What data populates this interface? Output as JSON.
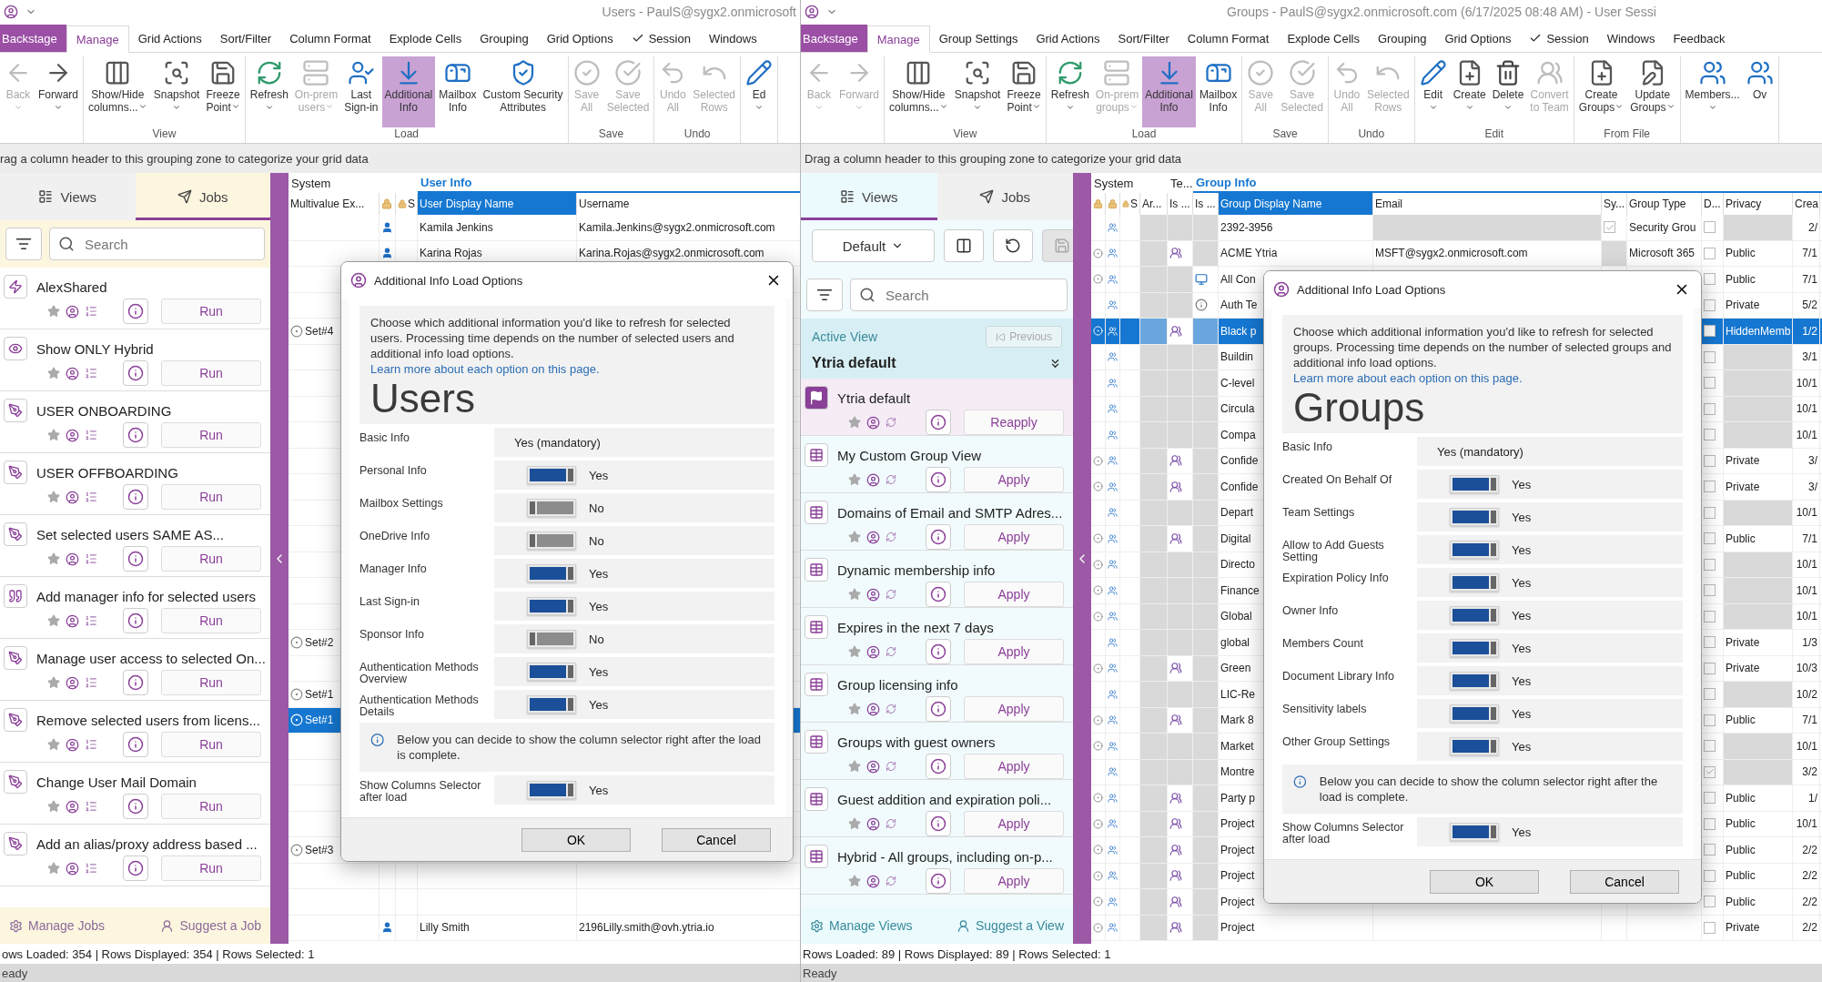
{
  "windows": [
    {
      "kind": "users",
      "title": "Users - PaulS@sygx2.onmicrosoft",
      "overlay_label": "Users",
      "tabs": [
        {
          "label": "Backstage",
          "kind": "backstage",
          "selected": false
        },
        {
          "label": "Manage",
          "kind": "tab",
          "selected": true
        },
        {
          "label": "Grid Actions",
          "kind": "tab",
          "selected": false
        },
        {
          "label": "Sort/Filter",
          "kind": "tab",
          "selected": false
        },
        {
          "label": "Column Format",
          "kind": "tab",
          "selected": false
        },
        {
          "label": "Explode Cells",
          "kind": "tab",
          "selected": false
        },
        {
          "label": "Grouping",
          "kind": "tab",
          "selected": false
        },
        {
          "label": "Grid Options",
          "kind": "tab",
          "selected": false
        },
        {
          "label": "Session",
          "kind": "check",
          "selected": false
        },
        {
          "label": "Windows",
          "kind": "tab",
          "selected": false
        }
      ],
      "ribbon": [
        {
          "buttons": [
            {
              "kind": "back",
              "label": "Back",
              "dropdown": true,
              "disabled": true,
              "highlighted": false
            },
            {
              "kind": "forward",
              "label": "Forward",
              "dropdown": true,
              "disabled": false,
              "highlighted": false
            }
          ]
        },
        {
          "label": "View",
          "buttons": [
            {
              "kind": "columns",
              "label": "Show/Hide\ncolumns...",
              "dropdown": true,
              "disabled": false,
              "highlighted": false
            },
            {
              "kind": "snapshot",
              "label": "Snapshot",
              "dropdown": true,
              "disabled": false,
              "highlighted": false
            },
            {
              "kind": "freeze",
              "label": "Freeze\nPoint",
              "dropdown": true,
              "disabled": false,
              "highlighted": false
            }
          ]
        },
        {
          "label": "Load",
          "buttons": [
            {
              "kind": "refresh",
              "label": "Refresh",
              "dropdown": true,
              "disabled": false,
              "highlighted": false
            },
            {
              "kind": "server",
              "label": "On-prem\nusers",
              "dropdown": true,
              "disabled": true,
              "highlighted": false
            },
            {
              "kind": "signin",
              "label": "Last\nSign-in",
              "dropdown": false,
              "disabled": false,
              "highlighted": false
            },
            {
              "kind": "download",
              "label": "Additional\nInfo",
              "dropdown": false,
              "disabled": false,
              "highlighted": true
            },
            {
              "kind": "mailbox",
              "label": "Mailbox\nInfo",
              "dropdown": false,
              "disabled": false,
              "highlighted": false
            },
            {
              "kind": "shield",
              "label": "Custom Security\nAttributes",
              "dropdown": false,
              "disabled": false,
              "highlighted": false
            }
          ]
        },
        {
          "label": "Save",
          "buttons": [
            {
              "kind": "saveall",
              "label": "Save\nAll",
              "dropdown": false,
              "disabled": true,
              "highlighted": false
            },
            {
              "kind": "savesel",
              "label": "Save\nSelected",
              "dropdown": false,
              "disabled": true,
              "highlighted": false
            }
          ]
        },
        {
          "label": "Undo",
          "buttons": [
            {
              "kind": "undo",
              "label": "Undo\nAll",
              "dropdown": false,
              "disabled": true,
              "highlighted": false
            },
            {
              "kind": "undosel",
              "label": "Selected\nRows",
              "dropdown": false,
              "disabled": true,
              "highlighted": false
            }
          ]
        },
        {
          "buttons": [
            {
              "kind": "edit",
              "label": "Ed",
              "dropdown": true,
              "disabled": false,
              "highlighted": false
            }
          ]
        }
      ],
      "group_hint": "rag a column header to this grouping zone to categorize your grid data",
      "panel": {
        "kind": "jobs",
        "tabs": [
          {
            "label": "Views",
            "selected": false
          },
          {
            "label": "Jobs",
            "selected": true
          }
        ],
        "search": {
          "placeholder": "Search"
        },
        "items": [
          {
            "title": "AlexShared",
            "kind": "bolt",
            "action": "Run"
          },
          {
            "title": "Show ONLY Hybrid",
            "kind": "eye",
            "action": "Run"
          },
          {
            "title": "USER ONBOARDING",
            "kind": "pen",
            "action": "Run"
          },
          {
            "title": "USER OFFBOARDING",
            "kind": "pen",
            "action": "Run"
          },
          {
            "title": "Set selected users SAME AS...",
            "kind": "pen",
            "action": "Run"
          },
          {
            "title": "Add manager info for selected users",
            "kind": "quote",
            "action": "Run"
          },
          {
            "title": "Manage user access to selected On...",
            "kind": "pen",
            "action": "Run"
          },
          {
            "title": "Remove selected users from licens...",
            "kind": "pen",
            "action": "Run"
          },
          {
            "title": "Change User Mail Domain",
            "kind": "pen",
            "action": "Run"
          },
          {
            "title": "Add an alias/proxy address based ...",
            "kind": "pen",
            "action": "Run"
          }
        ],
        "footer": [
          "Manage Jobs",
          "Suggest a Job"
        ]
      },
      "grid": {
        "header_groups": [
          "System",
          "User Info"
        ],
        "columns": [
          {
            "kind": "text",
            "label": "Multivalue Ex..."
          },
          {
            "kind": "lock"
          },
          {
            "kind": "lock",
            "label": "S"
          },
          {
            "kind": "sorted",
            "label": "User Display Name"
          },
          {
            "kind": "text",
            "label": "Username"
          }
        ],
        "rows": [
          {
            "selected": false,
            "name": "Kamila Jenkins",
            "username": "Kamila.Jenkins@sygx2.onmicrosoft.com"
          },
          {
            "selected": false,
            "name": "Karina Rojas",
            "username": "Karina.Rojas@sygx2.onmicrosoft.com"
          },
          {
            "selected": false
          },
          {
            "selected": false
          },
          {
            "selected": false,
            "set": "Set#4"
          },
          {
            "selected": false
          },
          {
            "selected": false
          },
          {
            "selected": false
          },
          {
            "selected": false
          },
          {
            "selected": false
          },
          {
            "selected": false
          },
          {
            "selected": false
          },
          {
            "selected": false
          },
          {
            "selected": false
          },
          {
            "selected": false
          },
          {
            "selected": false
          },
          {
            "selected": false,
            "set": "Set#2"
          },
          {
            "selected": false
          },
          {
            "selected": false,
            "set": "Set#1"
          },
          {
            "selected": true,
            "set": "Set#1"
          },
          {
            "selected": false
          },
          {
            "selected": false
          },
          {
            "selected": false
          },
          {
            "selected": false
          },
          {
            "selected": false,
            "set": "Set#3"
          },
          {
            "selected": false
          },
          {
            "selected": false
          },
          {
            "selected": false,
            "name": "Lilly Smith",
            "username": "2196Lilly.smith@ovh.ytria.io"
          }
        ]
      },
      "rows_info": "ows Loaded: 354 | Rows Displayed: 354 | Rows Selected: 1",
      "status": "eady",
      "dialog": {
        "title": "Additional Info Load Options",
        "description": "Choose which additional information you'd like to refresh for selected users. Processing time depends on the number of selected users and additional info load options.",
        "link": "Learn more about each option on this page.",
        "options": [
          {
            "label": "Basic Info",
            "kind": "fixed",
            "value": "Yes (mandatory)"
          },
          {
            "label": "Personal Info",
            "kind": "toggle",
            "on": true,
            "value": "Yes"
          },
          {
            "label": "Mailbox Settings",
            "kind": "toggle",
            "on": false,
            "value": "No"
          },
          {
            "label": "OneDrive Info",
            "kind": "toggle",
            "on": false,
            "value": "No"
          },
          {
            "label": "Manager Info",
            "kind": "toggle",
            "on": true,
            "value": "Yes"
          },
          {
            "label": "Last Sign-in",
            "kind": "toggle",
            "on": true,
            "value": "Yes"
          },
          {
            "label": "Sponsor Info",
            "kind": "toggle",
            "on": false,
            "value": "No"
          },
          {
            "label": "Authentication Methods Overview",
            "kind": "toggle",
            "on": true,
            "value": "Yes"
          },
          {
            "label": "Authentication Methods Details",
            "kind": "toggle",
            "on": true,
            "value": "Yes"
          }
        ],
        "note": "Below you can decide to show the column selector right after the load is complete.",
        "after_note": [
          {
            "label": "Show Columns Selector after load",
            "kind": "toggle",
            "on": true,
            "value": "Yes"
          }
        ],
        "buttons": [
          "OK",
          "Cancel"
        ]
      }
    },
    {
      "kind": "groups",
      "title": "Groups - PaulS@sygx2.onmicrosoft.com (6/17/2025 08:48 AM) - User Sessi",
      "overlay_label": "Groups",
      "tabs": [
        {
          "label": "Backstage",
          "kind": "backstage",
          "selected": false
        },
        {
          "label": "Manage",
          "kind": "tab",
          "selected": true
        },
        {
          "label": "Group Settings",
          "kind": "tab",
          "selected": false
        },
        {
          "label": "Grid Actions",
          "kind": "tab",
          "selected": false
        },
        {
          "label": "Sort/Filter",
          "kind": "tab",
          "selected": false
        },
        {
          "label": "Column Format",
          "kind": "tab",
          "selected": false
        },
        {
          "label": "Explode Cells",
          "kind": "tab",
          "selected": false
        },
        {
          "label": "Grouping",
          "kind": "tab",
          "selected": false
        },
        {
          "label": "Grid Options",
          "kind": "tab",
          "selected": false
        },
        {
          "label": "Session",
          "kind": "check",
          "selected": false
        },
        {
          "label": "Windows",
          "kind": "tab",
          "selected": false
        },
        {
          "label": "Feedback",
          "kind": "tab",
          "selected": false
        }
      ],
      "ribbon": [
        {
          "buttons": [
            {
              "kind": "back",
              "label": "Back",
              "dropdown": true,
              "disabled": true,
              "highlighted": false
            },
            {
              "kind": "forward",
              "label": "Forward",
              "dropdown": true,
              "disabled": true,
              "highlighted": false
            }
          ]
        },
        {
          "label": "View",
          "buttons": [
            {
              "kind": "columns",
              "label": "Show/Hide\ncolumns...",
              "dropdown": true,
              "disabled": false,
              "highlighted": false
            },
            {
              "kind": "snapshot",
              "label": "Snapshot",
              "dropdown": true,
              "disabled": false,
              "highlighted": false
            },
            {
              "kind": "freeze",
              "label": "Freeze\nPoint",
              "dropdown": true,
              "disabled": false,
              "highlighted": false
            }
          ]
        },
        {
          "label": "Load",
          "buttons": [
            {
              "kind": "refresh",
              "label": "Refresh",
              "dropdown": true,
              "disabled": false,
              "highlighted": false
            },
            {
              "kind": "server",
              "label": "On-prem\ngroups",
              "dropdown": true,
              "disabled": true,
              "highlighted": false
            },
            {
              "kind": "download",
              "label": "Additional\nInfo",
              "dropdown": false,
              "disabled": false,
              "highlighted": true
            },
            {
              "kind": "mailbox",
              "label": "Mailbox\nInfo",
              "dropdown": false,
              "disabled": false,
              "highlighted": false
            }
          ]
        },
        {
          "label": "Save",
          "buttons": [
            {
              "kind": "saveall",
              "label": "Save\nAll",
              "dropdown": false,
              "disabled": true,
              "highlighted": false
            },
            {
              "kind": "savesel",
              "label": "Save\nSelected",
              "dropdown": false,
              "disabled": true,
              "highlighted": false
            }
          ]
        },
        {
          "label": "Undo",
          "buttons": [
            {
              "kind": "undo",
              "label": "Undo\nAll",
              "dropdown": false,
              "disabled": true,
              "highlighted": false
            },
            {
              "kind": "undosel",
              "label": "Selected\nRows",
              "dropdown": false,
              "disabled": true,
              "highlighted": false
            }
          ]
        },
        {
          "label": "Edit",
          "buttons": [
            {
              "kind": "edit",
              "label": "Edit",
              "dropdown": true,
              "disabled": false,
              "highlighted": false
            },
            {
              "kind": "create",
              "label": "Create",
              "dropdown": true,
              "disabled": false,
              "highlighted": false
            },
            {
              "kind": "delete",
              "label": "Delete",
              "dropdown": true,
              "disabled": false,
              "highlighted": false
            },
            {
              "kind": "teams",
              "label": "Convert\nto Team",
              "dropdown": false,
              "disabled": true,
              "highlighted": false
            }
          ]
        },
        {
          "label": "From File",
          "buttons": [
            {
              "kind": "filecreate",
              "label": "Create\nGroups",
              "dropdown": true,
              "disabled": false,
              "highlighted": false
            },
            {
              "kind": "fileupdate",
              "label": "Update\nGroups",
              "dropdown": true,
              "disabled": false,
              "highlighted": false
            }
          ]
        },
        {
          "buttons": [
            {
              "kind": "members",
              "label": "Members...",
              "dropdown": true,
              "disabled": false,
              "highlighted": false
            },
            {
              "kind": "members",
              "label": "Ov",
              "dropdown": false,
              "disabled": false,
              "highlighted": false
            }
          ]
        }
      ],
      "group_hint": "Drag a column header to this grouping zone to categorize your grid data",
      "panel": {
        "kind": "views",
        "tabs": [
          {
            "label": "Views",
            "selected": true
          },
          {
            "label": "Jobs",
            "selected": false
          }
        ],
        "view_select": "Default",
        "search": {
          "placeholder": "Search"
        },
        "active_view": {
          "label": "Active View",
          "previous": "Previous",
          "name": "Ytria default"
        },
        "items": [
          {
            "title": "Ytria default",
            "active": true,
            "action": "Reapply"
          },
          {
            "title": "My Custom Group View",
            "active": false,
            "action": "Apply"
          },
          {
            "title": "Domains of Email and SMTP Adres...",
            "active": false,
            "action": "Apply"
          },
          {
            "title": "Dynamic membership info",
            "active": false,
            "action": "Apply"
          },
          {
            "title": "Expires in the next 7 days",
            "active": false,
            "action": "Apply"
          },
          {
            "title": "Group licensing info",
            "active": false,
            "action": "Apply"
          },
          {
            "title": "Groups with guest owners",
            "active": false,
            "action": "Apply"
          },
          {
            "title": "Guest addition and expiration poli...",
            "active": false,
            "action": "Apply"
          },
          {
            "title": "Hybrid - All groups, including on-p...",
            "active": false,
            "action": "Apply"
          }
        ],
        "footer": [
          "Manage Views",
          "Suggest a View"
        ]
      },
      "grid": {
        "header_groups": [
          "System",
          "Te...",
          "Group Info"
        ],
        "columns": [
          {
            "kind": "lock"
          },
          {
            "kind": "lock"
          },
          {
            "kind": "lock",
            "label": "S"
          },
          {
            "kind": "text",
            "label": "Ar..."
          },
          {
            "kind": "text",
            "label": "Is ..."
          },
          {
            "kind": "text",
            "label": "Is ..."
          },
          {
            "kind": "sorted",
            "label": "Group Display Name"
          },
          {
            "kind": "text",
            "label": "Email"
          },
          {
            "kind": "text",
            "label": "Sy..."
          },
          {
            "kind": "text",
            "label": "Group Type"
          },
          {
            "kind": "text",
            "label": "D..."
          },
          {
            "kind": "text",
            "label": "Privacy"
          },
          {
            "kind": "text",
            "label": "Crea"
          }
        ],
        "rows": [
          {
            "name": "2392-3956",
            "radio": false,
            "kind": "none",
            "sy_checked": true,
            "group_type": "Security Grou",
            "d_checked": false,
            "created": "2/",
            "selected": false
          },
          {
            "name": "ACME Ytria",
            "radio": true,
            "kind": "teams",
            "email": "MSFT@sygx2.onmicrosoft.com",
            "group_type": "Microsoft 365",
            "d_checked": false,
            "privacy": "Public",
            "created": "7/1",
            "selected": false
          },
          {
            "name": "All Con",
            "radio": true,
            "kind": "windows",
            "d_checked": false,
            "privacy": "Public",
            "created": "7/1",
            "selected": false
          },
          {
            "name": "Auth Te",
            "radio": false,
            "kind": "info",
            "d_checked": false,
            "privacy": "Private",
            "created": "5/2",
            "selected": false
          },
          {
            "name": "Black p",
            "radio": true,
            "kind": "teams",
            "d_checked": false,
            "privacy": "HiddenMemb",
            "created": "1/2",
            "selected": true
          },
          {
            "name": "Buildin",
            "radio": false,
            "kind": "none",
            "d_checked": false,
            "created": "3/1",
            "selected": false
          },
          {
            "name": "C-level",
            "radio": false,
            "kind": "none",
            "d_checked": false,
            "created": "10/1",
            "selected": false
          },
          {
            "name": "Circula",
            "radio": false,
            "kind": "none",
            "d_checked": false,
            "created": "10/1",
            "selected": false
          },
          {
            "name": "Compa",
            "radio": false,
            "kind": "none",
            "d_checked": false,
            "created": "10/1",
            "selected": false
          },
          {
            "name": "Confide",
            "radio": true,
            "kind": "teams",
            "d_checked": false,
            "privacy": "Private",
            "created": "3/",
            "selected": false
          },
          {
            "name": "Confide",
            "radio": true,
            "kind": "teams",
            "d_checked": false,
            "privacy": "Private",
            "created": "3/",
            "selected": false
          },
          {
            "name": "Depart",
            "radio": false,
            "kind": "none",
            "d_checked": false,
            "created": "10/1",
            "selected": false
          },
          {
            "name": "Digital",
            "radio": true,
            "kind": "teams",
            "d_checked": false,
            "privacy": "Public",
            "created": "7/1",
            "selected": false
          },
          {
            "name": "Directo",
            "radio": true,
            "kind": "none",
            "d_checked": false,
            "created": "10/1",
            "selected": false
          },
          {
            "name": "Finance",
            "radio": true,
            "kind": "none",
            "d_checked": false,
            "created": "10/1",
            "selected": false
          },
          {
            "name": "Global",
            "radio": true,
            "kind": "none",
            "d_checked": false,
            "created": "10/1",
            "selected": false
          },
          {
            "name": "global",
            "radio": false,
            "kind": "none",
            "d_checked": false,
            "privacy": "Private",
            "created": "1/3",
            "selected": false
          },
          {
            "name": "Green",
            "radio": true,
            "kind": "teams",
            "d_checked": false,
            "privacy": "Private",
            "created": "10/3",
            "selected": false
          },
          {
            "name": "LIC-Re",
            "radio": false,
            "kind": "none",
            "d_checked": false,
            "created": "10/2",
            "selected": false
          },
          {
            "name": "Mark 8",
            "radio": true,
            "kind": "teams",
            "d_checked": false,
            "privacy": "Public",
            "created": "7/1",
            "selected": false
          },
          {
            "name": "Market",
            "radio": true,
            "kind": "none",
            "d_checked": false,
            "created": "10/1",
            "selected": false
          },
          {
            "name": "Montre",
            "radio": false,
            "kind": "none",
            "d_checked": true,
            "created": "3/2",
            "selected": false
          },
          {
            "name": "Party p",
            "radio": true,
            "kind": "teams",
            "d_checked": false,
            "privacy": "Public",
            "created": "1/",
            "selected": false
          },
          {
            "name": "Project",
            "radio": true,
            "kind": "teams",
            "d_checked": false,
            "privacy": "Public",
            "created": "10/1",
            "selected": false
          },
          {
            "name": "Project",
            "radio": true,
            "kind": "teams",
            "d_checked": false,
            "privacy": "Public",
            "created": "2/2",
            "selected": false
          },
          {
            "name": "Project",
            "radio": true,
            "kind": "teams",
            "d_checked": false,
            "privacy": "Public",
            "created": "2/2",
            "selected": false
          },
          {
            "name": "Project",
            "radio": true,
            "kind": "teams",
            "d_checked": false,
            "privacy": "Public",
            "created": "2/2",
            "selected": false
          },
          {
            "name": "Project",
            "radio": true,
            "kind": "teams",
            "d_checked": false,
            "privacy": "Private",
            "created": "2/2",
            "selected": false
          }
        ]
      },
      "rows_info": "Rows Loaded: 89 | Rows Displayed: 89 | Rows Selected: 1",
      "status": "Ready",
      "dialog": {
        "title": "Additional Info Load Options",
        "description": "Choose which additional information you'd like to refresh for selected groups. Processing time depends on the number of selected groups and additional info load options.",
        "link": "Learn more about each option on this page.",
        "options": [
          {
            "label": "Basic Info",
            "kind": "fixed",
            "value": "Yes (mandatory)"
          },
          {
            "label": "Created On Behalf Of",
            "kind": "toggle",
            "on": true,
            "value": "Yes"
          },
          {
            "label": "Team Settings",
            "kind": "toggle",
            "on": true,
            "value": "Yes"
          },
          {
            "label": "Allow to Add Guests Setting",
            "kind": "toggle",
            "on": true,
            "value": "Yes"
          },
          {
            "label": "Expiration Policy Info",
            "kind": "toggle",
            "on": true,
            "value": "Yes"
          },
          {
            "label": "Owner Info",
            "kind": "toggle",
            "on": true,
            "value": "Yes"
          },
          {
            "label": "Members Count",
            "kind": "toggle",
            "on": true,
            "value": "Yes"
          },
          {
            "label": "Document Library Info",
            "kind": "toggle",
            "on": true,
            "value": "Yes"
          },
          {
            "label": "Sensitivity labels",
            "kind": "toggle",
            "on": true,
            "value": "Yes"
          },
          {
            "label": "Other Group Settings",
            "kind": "toggle",
            "on": true,
            "value": "Yes"
          }
        ],
        "note": "Below you can decide to show the column selector right after the load is complete.",
        "after_note": [
          {
            "label": "Show Columns Selector after load",
            "kind": "toggle",
            "on": true,
            "value": "Yes"
          }
        ],
        "buttons": [
          "OK",
          "Cancel"
        ]
      }
    }
  ]
}
